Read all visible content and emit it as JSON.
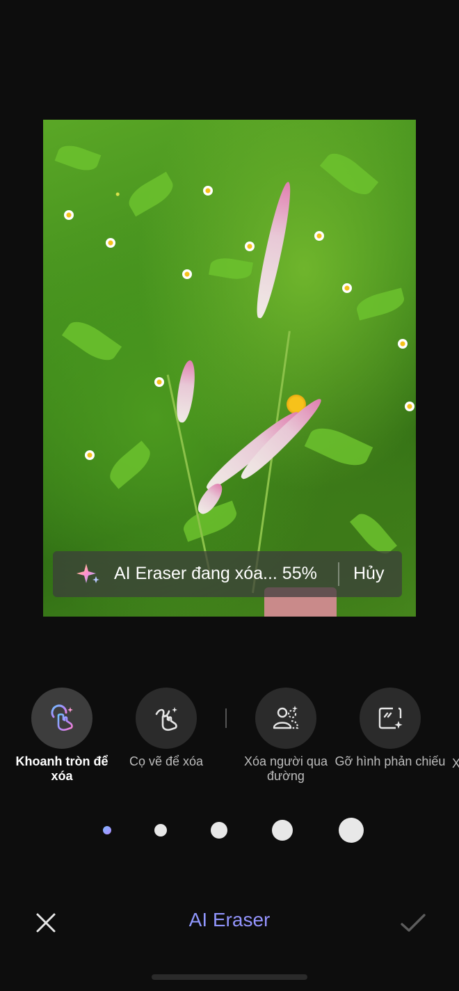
{
  "banner": {
    "status": "AI Eraser đang xóa... 55%",
    "progress_percent": 55,
    "cancel": "Hủy"
  },
  "tools": [
    {
      "label": "Khoanh tròn để xóa",
      "icon": "circle-select-icon",
      "active": true
    },
    {
      "label": "Cọ vẽ để xóa",
      "icon": "brush-erase-icon",
      "active": false
    },
    {
      "label": "Xóa người qua đường",
      "icon": "remove-people-icon",
      "active": false
    },
    {
      "label": "Gỡ hình phản chiếu",
      "icon": "remove-reflection-icon",
      "active": false
    },
    {
      "label": "X",
      "icon": "",
      "active": false
    }
  ],
  "brush_sizes": {
    "count": 5,
    "selected_index": 0
  },
  "bottom_bar": {
    "title": "AI Eraser",
    "close_icon": "close-icon",
    "confirm_icon": "check-icon"
  },
  "colors": {
    "background": "#0d0d0d",
    "accent_gradient_start": "#7ea0ff",
    "accent_gradient_end": "#a88cff"
  }
}
